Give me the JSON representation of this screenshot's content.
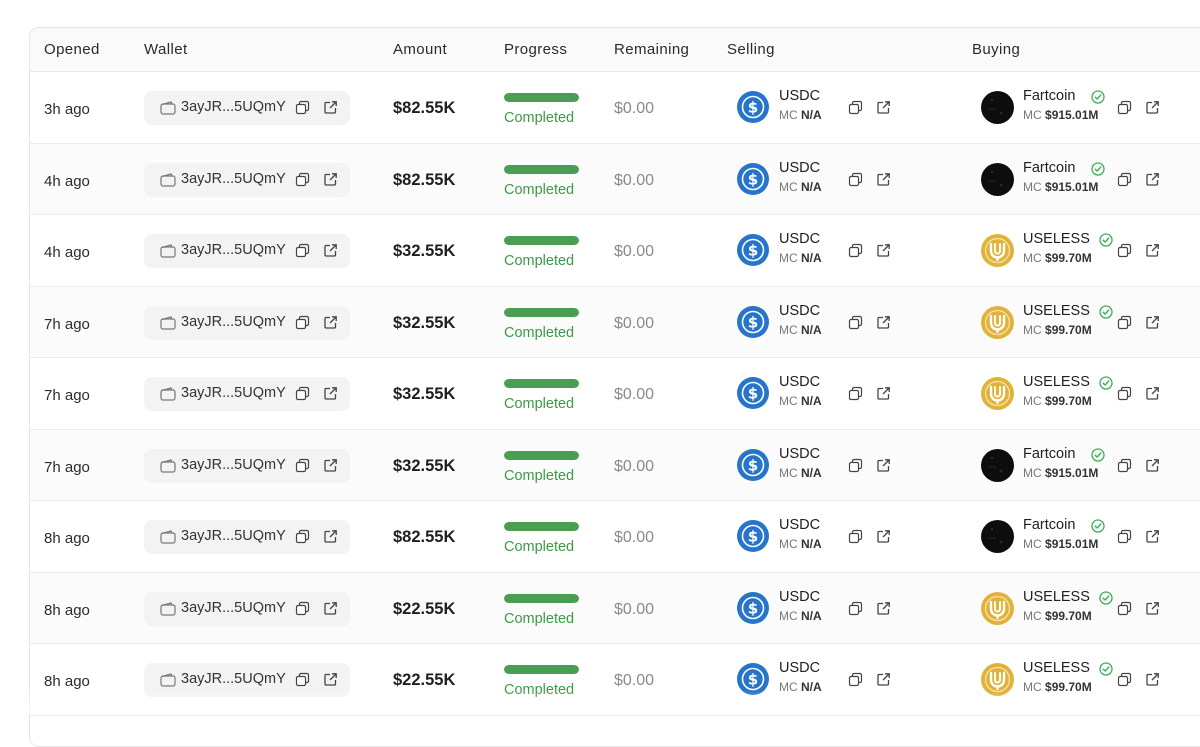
{
  "table": {
    "headers": {
      "opened": "Opened",
      "wallet": "Wallet",
      "amount": "Amount",
      "progress": "Progress",
      "remaining": "Remaining",
      "selling": "Selling",
      "buying": "Buying"
    },
    "mc_label": "MC",
    "rows": [
      {
        "opened": "3h ago",
        "wallet": "3ayJR...5UQmY",
        "amount": "$82.55K",
        "progress": 1.0,
        "status": "Completed",
        "remaining": "$0.00",
        "sell_symbol": "USDC",
        "sell_mc": "N/A",
        "sell_icon": "usdc-icon",
        "buy_symbol": "Fartcoin",
        "buy_mc": "$915.01M",
        "buy_icon": "fartcoin-icon"
      },
      {
        "opened": "4h ago",
        "wallet": "3ayJR...5UQmY",
        "amount": "$82.55K",
        "progress": 1.0,
        "status": "Completed",
        "remaining": "$0.00",
        "sell_symbol": "USDC",
        "sell_mc": "N/A",
        "sell_icon": "usdc-icon",
        "buy_symbol": "Fartcoin",
        "buy_mc": "$915.01M",
        "buy_icon": "fartcoin-icon"
      },
      {
        "opened": "4h ago",
        "wallet": "3ayJR...5UQmY",
        "amount": "$32.55K",
        "progress": 1.0,
        "status": "Completed",
        "remaining": "$0.00",
        "sell_symbol": "USDC",
        "sell_mc": "N/A",
        "sell_icon": "usdc-icon",
        "buy_symbol": "USELESS",
        "buy_mc": "$99.70M",
        "buy_icon": "useless-icon"
      },
      {
        "opened": "7h ago",
        "wallet": "3ayJR...5UQmY",
        "amount": "$32.55K",
        "progress": 1.0,
        "status": "Completed",
        "remaining": "$0.00",
        "sell_symbol": "USDC",
        "sell_mc": "N/A",
        "sell_icon": "usdc-icon",
        "buy_symbol": "USELESS",
        "buy_mc": "$99.70M",
        "buy_icon": "useless-icon"
      },
      {
        "opened": "7h ago",
        "wallet": "3ayJR...5UQmY",
        "amount": "$32.55K",
        "progress": 1.0,
        "status": "Completed",
        "remaining": "$0.00",
        "sell_symbol": "USDC",
        "sell_mc": "N/A",
        "sell_icon": "usdc-icon",
        "buy_symbol": "USELESS",
        "buy_mc": "$99.70M",
        "buy_icon": "useless-icon"
      },
      {
        "opened": "7h ago",
        "wallet": "3ayJR...5UQmY",
        "amount": "$32.55K",
        "progress": 1.0,
        "status": "Completed",
        "remaining": "$0.00",
        "sell_symbol": "USDC",
        "sell_mc": "N/A",
        "sell_icon": "usdc-icon",
        "buy_symbol": "Fartcoin",
        "buy_mc": "$915.01M",
        "buy_icon": "fartcoin-icon"
      },
      {
        "opened": "8h ago",
        "wallet": "3ayJR...5UQmY",
        "amount": "$82.55K",
        "progress": 1.0,
        "status": "Completed",
        "remaining": "$0.00",
        "sell_symbol": "USDC",
        "sell_mc": "N/A",
        "sell_icon": "usdc-icon",
        "buy_symbol": "Fartcoin",
        "buy_mc": "$915.01M",
        "buy_icon": "fartcoin-icon"
      },
      {
        "opened": "8h ago",
        "wallet": "3ayJR...5UQmY",
        "amount": "$22.55K",
        "progress": 1.0,
        "status": "Completed",
        "remaining": "$0.00",
        "sell_symbol": "USDC",
        "sell_mc": "N/A",
        "sell_icon": "usdc-icon",
        "buy_symbol": "USELESS",
        "buy_mc": "$99.70M",
        "buy_icon": "useless-icon"
      },
      {
        "opened": "8h ago",
        "wallet": "3ayJR...5UQmY",
        "amount": "$22.55K",
        "progress": 1.0,
        "status": "Completed",
        "remaining": "$0.00",
        "sell_symbol": "USDC",
        "sell_mc": "N/A",
        "sell_icon": "usdc-icon",
        "buy_symbol": "USELESS",
        "buy_mc": "$99.70M",
        "buy_icon": "useless-icon"
      }
    ]
  },
  "colors": {
    "progress_fill": "#4a9e54",
    "status_text": "#3b9a48",
    "usdc_blue": "#2775ca",
    "useless_gold": "#e0b23a",
    "verified_green": "#3fae5a"
  }
}
